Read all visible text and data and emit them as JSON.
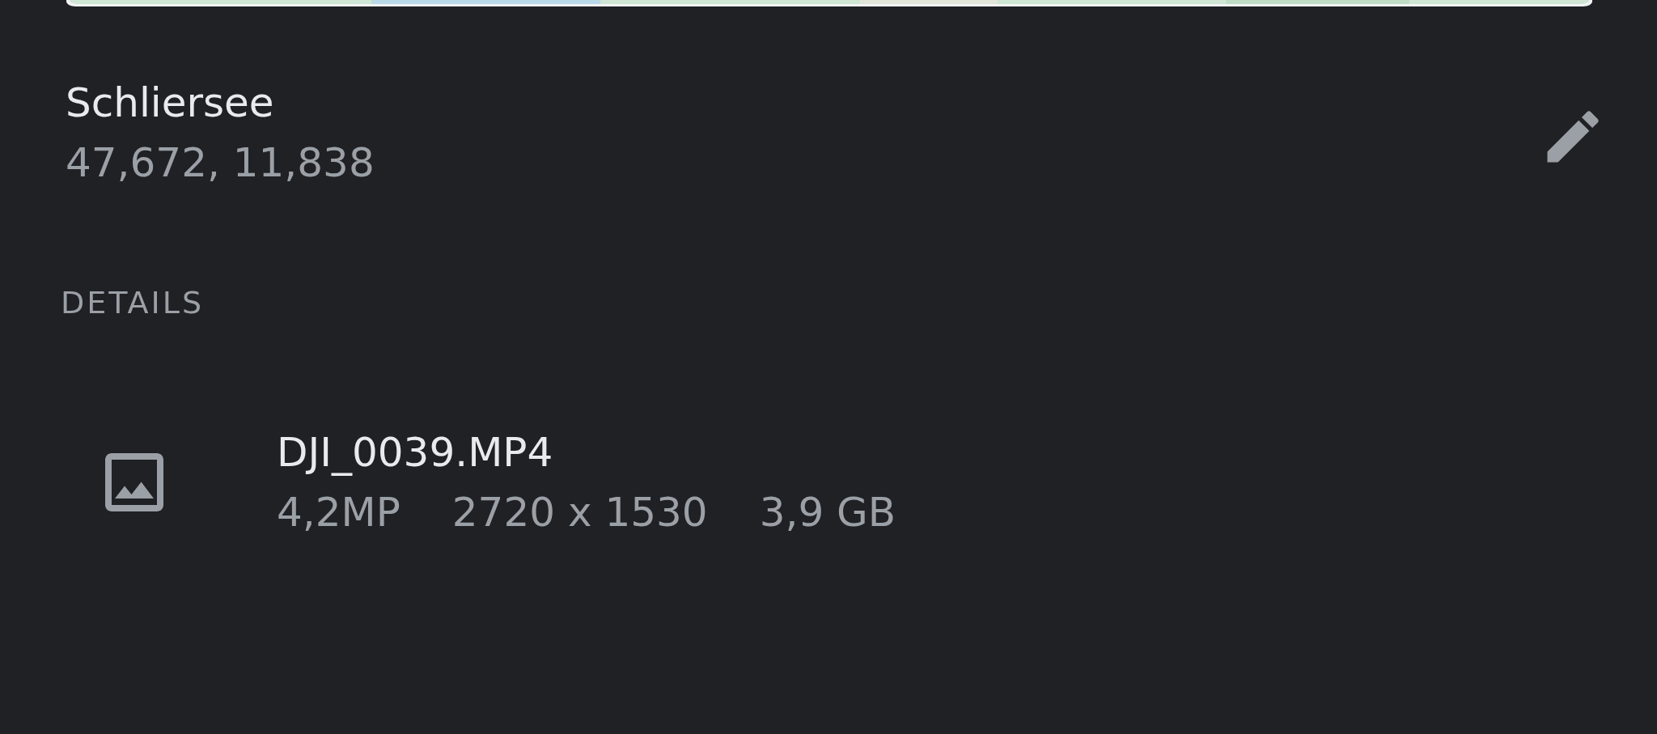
{
  "location": {
    "name": "Schliersee",
    "coordinates": "47,672, 11,838"
  },
  "details": {
    "heading": "DETAILS",
    "file": {
      "name": "DJI_0039.MP4",
      "specs": [
        "4,2MP",
        "2720 x 1530",
        "3,9 GB"
      ]
    }
  }
}
